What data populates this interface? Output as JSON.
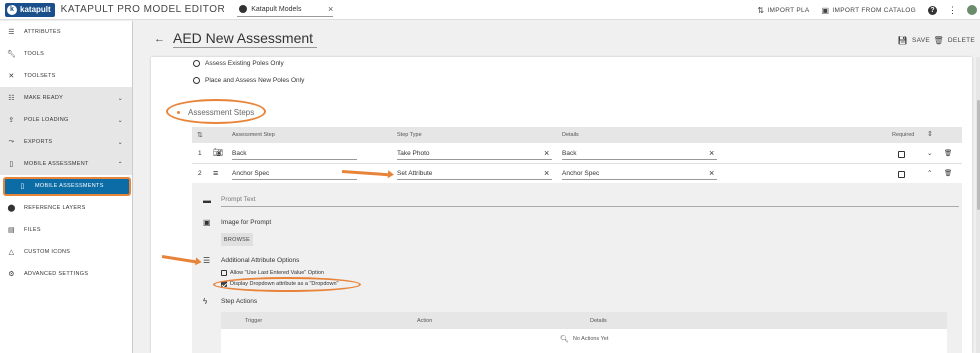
{
  "header": {
    "logo_text": "katapult",
    "app_title": "KATAPULT PRO MODEL EDITOR",
    "model_select": "Katapult Models",
    "import_pla": "IMPORT PLA",
    "import_catalog": "IMPORT FROM CATALOG",
    "help": "?"
  },
  "sidebar": {
    "items": [
      {
        "label": "ATTRIBUTES",
        "icon": "list-icon"
      },
      {
        "label": "TOOLS",
        "icon": "wrench-icon"
      },
      {
        "label": "TOOLSETS",
        "icon": "tools-icon"
      },
      {
        "label": "MAKE READY",
        "icon": "checklist-icon"
      },
      {
        "label": "POLE LOADING",
        "icon": "upload-icon"
      },
      {
        "label": "EXPORTS",
        "icon": "export-icon"
      },
      {
        "label": "MOBILE ASSESSMENT",
        "icon": "phone-icon"
      },
      {
        "label": "MOBILE ASSESSMENTS",
        "icon": "phone-icon"
      },
      {
        "label": "REFERENCE LAYERS",
        "icon": "pin-icon"
      },
      {
        "label": "FILES",
        "icon": "file-icon"
      },
      {
        "label": "CUSTOM ICONS",
        "icon": "triangle-icon"
      },
      {
        "label": "ADVANCED SETTINGS",
        "icon": "gear-icon"
      }
    ]
  },
  "main": {
    "title": "AED New Assessment",
    "save": "SAVE",
    "delete": "DELETE",
    "radio_options": [
      "Assess Existing Poles Only",
      "Place and Assess New Poles Only"
    ],
    "section_title": "Assessment Steps",
    "table_headers": [
      "Assessment Step",
      "Step Type",
      "Details",
      "Required"
    ],
    "rows": [
      {
        "num": "1",
        "step": "Back",
        "type": "Take Photo",
        "details": "Back",
        "required": false
      },
      {
        "num": "2",
        "step": "Anchor Spec",
        "type": "Set Attribute",
        "details": "Anchor Spec",
        "required": false
      }
    ],
    "prompt_placeholder": "Prompt Text",
    "image_prompt_label": "Image for Prompt",
    "browse": "BROWSE",
    "additional_options_label": "Additional Attribute Options",
    "option_last_value": "Allow \"Use Last Entered Value\" Option",
    "option_dropdown": "Display Dropdown attribute as a \"Dropdown\"",
    "step_actions_label": "Step Actions",
    "actions_headers": [
      "Trigger",
      "Action",
      "Details"
    ],
    "no_actions": "No Actions Yet"
  },
  "colors": {
    "accent_orange": "#e8843a",
    "active_blue": "#0c6ca6",
    "logo_blue": "#1a4f8b"
  }
}
